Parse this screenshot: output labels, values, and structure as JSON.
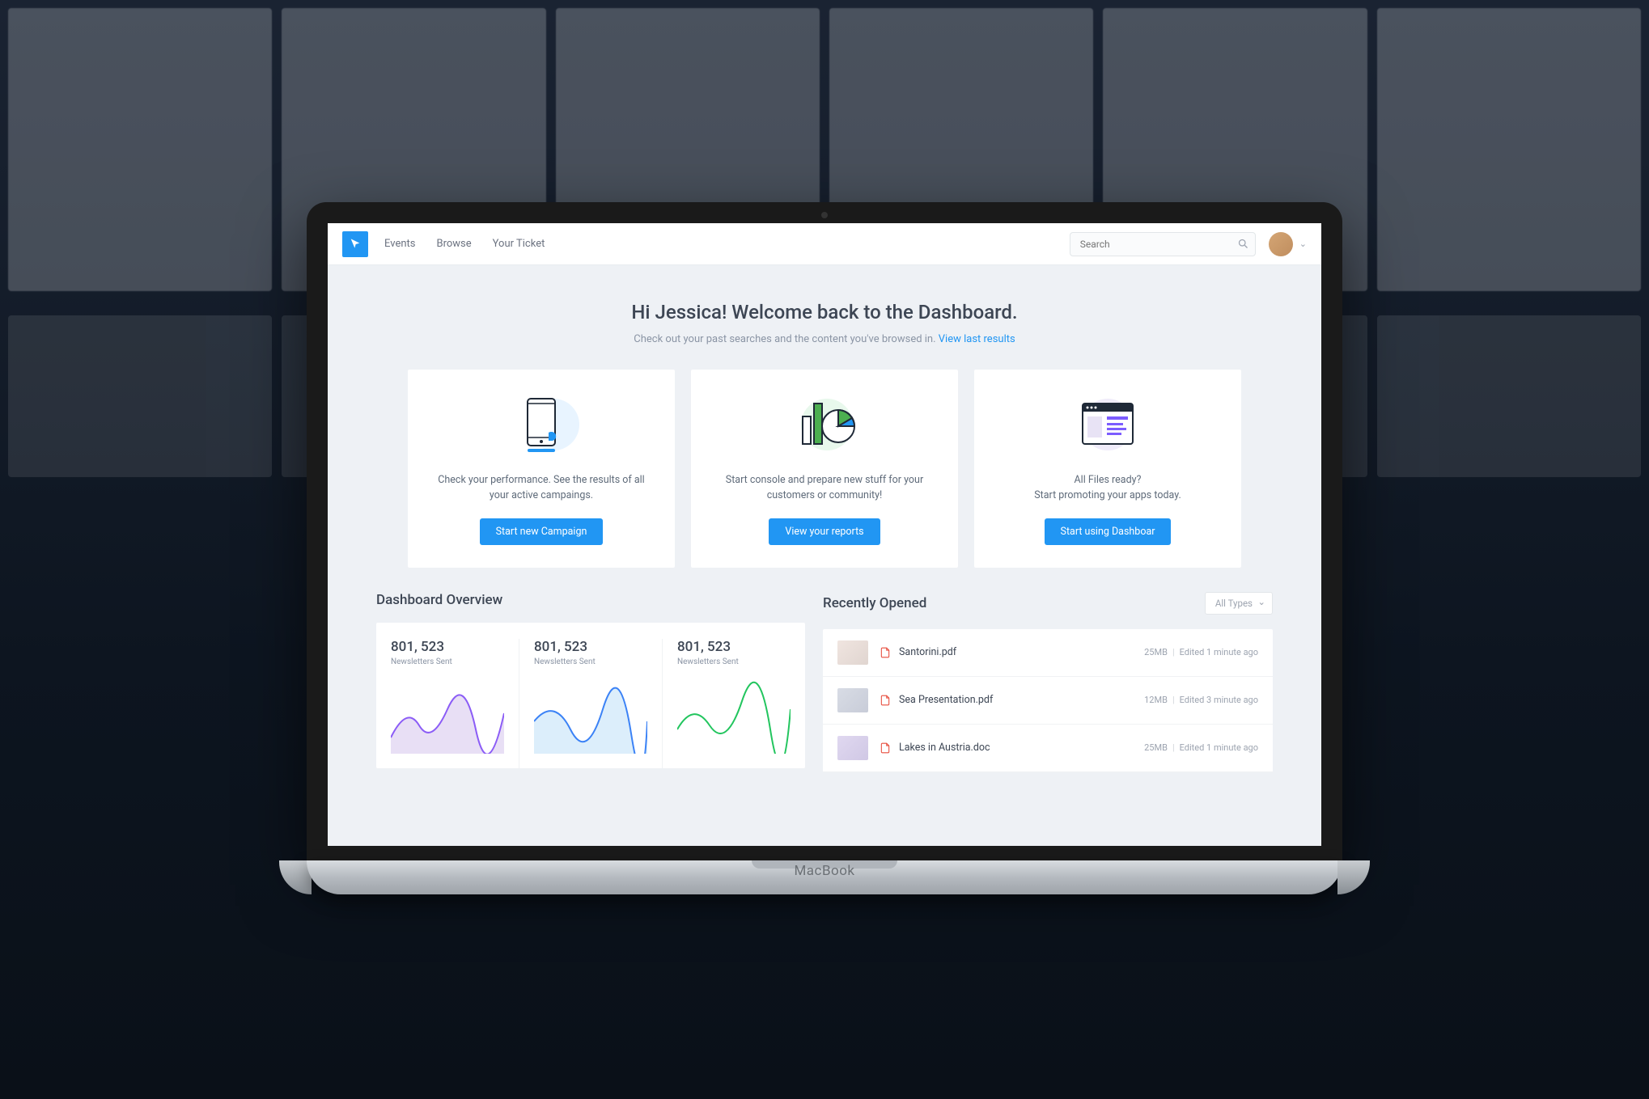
{
  "nav": {
    "events": "Events",
    "browse": "Browse",
    "ticket": "Your Ticket"
  },
  "search": {
    "placeholder": "Search"
  },
  "welcome": {
    "title": "Hi Jessica! Welcome back to the Dashboard.",
    "subtitle": "Check out your past searches and the content you've browsed in. ",
    "link": "View last results"
  },
  "cards": [
    {
      "text": "Check your performance. See the results of all your active campaings.",
      "button": "Start new Campaign"
    },
    {
      "text": "Start console and prepare new stuff for your customers or community!",
      "button": "View your reports"
    },
    {
      "text1": "All Files ready?",
      "text2": "Start promoting your apps today.",
      "button": "Start using Dashboar"
    }
  ],
  "overview": {
    "title": "Dashboard Overview",
    "stats": [
      {
        "value": "801, 523",
        "label": "Newsletters Sent"
      },
      {
        "value": "801, 523",
        "label": "Newsletters Sent"
      },
      {
        "value": "801, 523",
        "label": "Newsletters Sent"
      }
    ]
  },
  "recent": {
    "title": "Recently Opened",
    "filter": "All Types",
    "items": [
      {
        "name": "Santorini.pdf",
        "size": "25MB",
        "edited": "Edited 1 minute ago"
      },
      {
        "name": "Sea Presentation.pdf",
        "size": "12MB",
        "edited": "Edited 3 minute ago"
      },
      {
        "name": "Lakes in Austria.doc",
        "size": "25MB",
        "edited": "Edited 1 minute ago"
      }
    ]
  },
  "device": "MacBook"
}
